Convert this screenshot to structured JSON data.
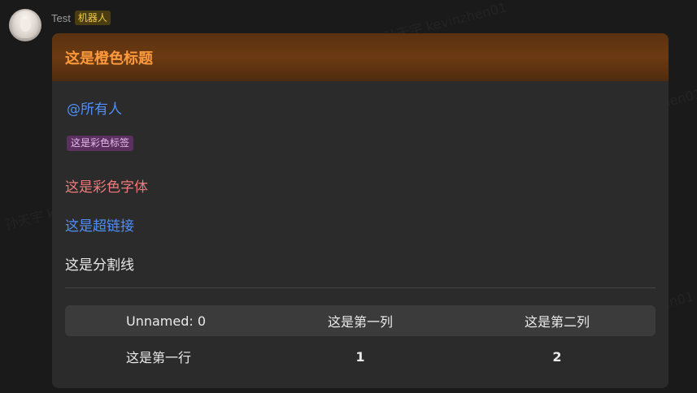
{
  "sender": {
    "name": "Test",
    "badge": "机器人"
  },
  "card": {
    "title": "这是橙色标题",
    "mention": "@所有人",
    "tag": "这是彩色标签",
    "colored_text": "这是彩色字体",
    "hyperlink": "这是超链接",
    "divider_label": "这是分割线",
    "table": {
      "columns": [
        "Unnamed: 0",
        "这是第一列",
        "这是第二列"
      ],
      "rows": [
        [
          "这是第一行",
          "1",
          "2"
        ]
      ]
    }
  },
  "watermark_text": "孙天宇 kevinzhen01",
  "colors": {
    "title": "#ff9a3c",
    "mention": "#4f8ff7",
    "tag_bg": "#5b2f5e",
    "colored_text": "#f07a7a",
    "link": "#4f8ff7",
    "badge": "#f2c94c"
  }
}
